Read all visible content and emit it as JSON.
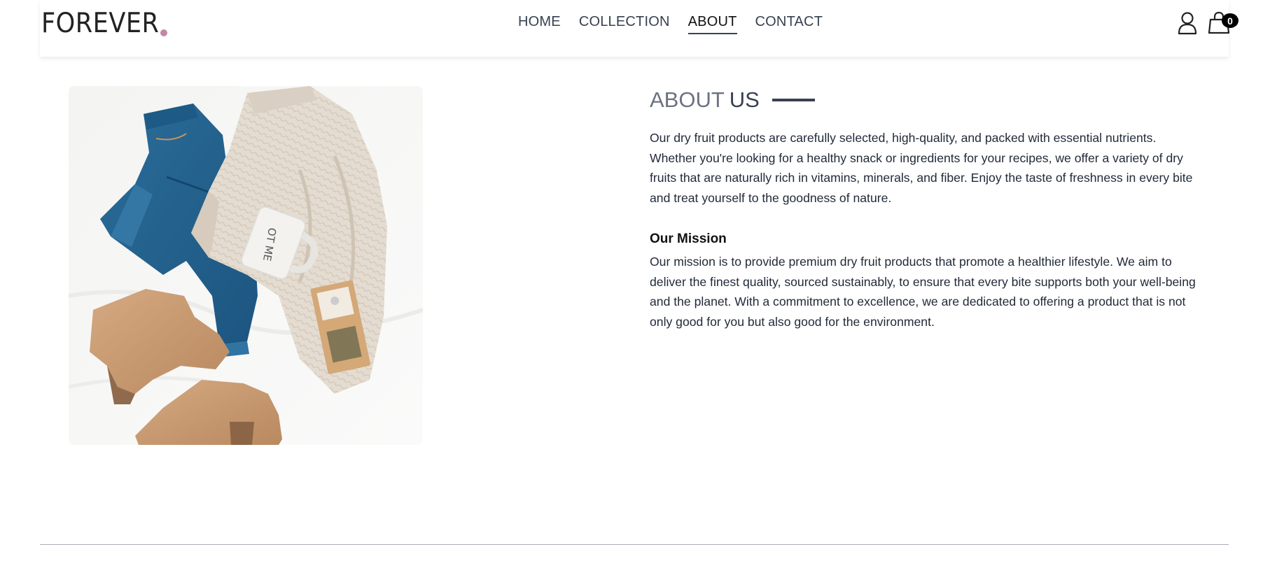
{
  "header": {
    "logo_text": "FOREVER",
    "logo_dot_color": "#c586a5",
    "nav": [
      {
        "label": "HOME",
        "active": false
      },
      {
        "label": "COLLECTION",
        "active": false
      },
      {
        "label": "ABOUT",
        "active": true
      },
      {
        "label": "CONTACT",
        "active": false
      }
    ],
    "cart_count": "0",
    "icons": [
      "profile-icon",
      "cart-icon"
    ]
  },
  "about": {
    "title_part1": "ABOUT",
    "title_part2": "US",
    "description": "Our dry fruit products are carefully selected, high-quality, and packed with essential nutrients. Whether you're looking for a healthy snack or ingredients for your recipes, we offer a variety of dry fruits that are naturally rich in vitamins, minerals, and fiber. Enjoy the taste of freshness in every bite and treat yourself to the goodness of nature.",
    "mission_heading": "Our Mission",
    "mission_text": "Our mission is to provide premium dry fruit products that promote a healthier lifestyle. We aim to deliver the finest quality, sourced sustainably, to ensure that every bite supports both your well-being and the planet. With a commitment to excellence, we are dedicated to offering a product that is not only good for you but also good for the environment.",
    "image_mug_text": "OT ME"
  },
  "colors": {
    "accent": "#374151",
    "muted": "#6b7280",
    "divider": "#a9adb8"
  }
}
